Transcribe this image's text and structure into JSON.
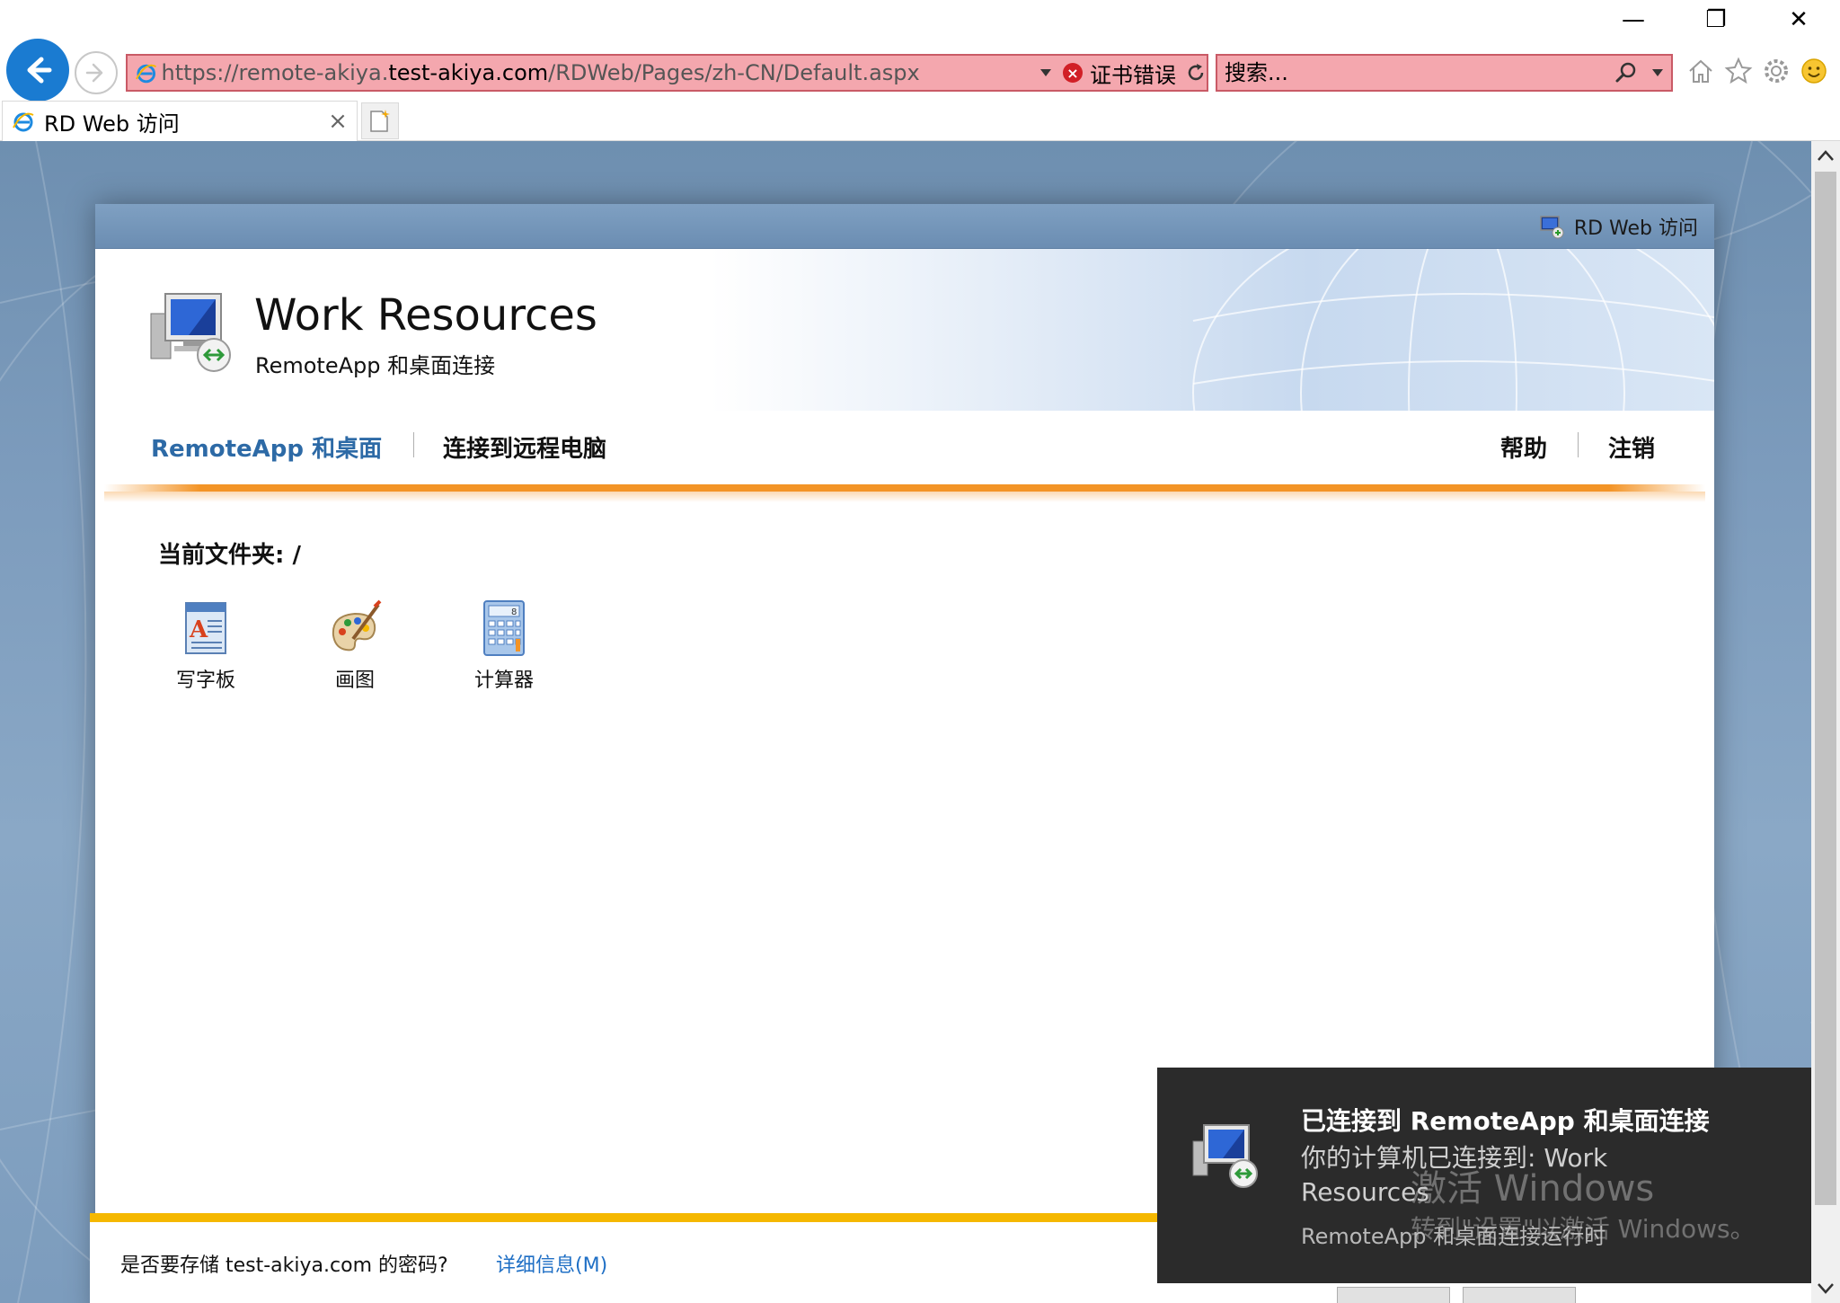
{
  "window": {
    "minimize_glyph": "—",
    "restore_glyph": "❐",
    "close_glyph": "✕"
  },
  "address": {
    "url_prefix": "https://remote-akiya.",
    "url_host": "test-akiya.com",
    "url_path": "/RDWeb/Pages/zh-CN/Default.aspx",
    "cert_error": "证书错误"
  },
  "search": {
    "placeholder": "搜索..."
  },
  "tab": {
    "title": "RD Web 访问",
    "close_glyph": "×"
  },
  "panel": {
    "topbar_label": "RD Web 访问",
    "title": "Work Resources",
    "subtitle": "RemoteApp 和桌面连接"
  },
  "nav": {
    "remoteapp": "RemoteApp 和桌面",
    "connect": "连接到远程电脑",
    "help": "帮助",
    "logout": "注销"
  },
  "folder": {
    "label": "当前文件夹: /"
  },
  "apps": [
    {
      "label": "写字板",
      "icon": "wordpad-icon"
    },
    {
      "label": "画图",
      "icon": "paint-icon"
    },
    {
      "label": "计算器",
      "icon": "calculator-icon"
    }
  ],
  "password_bar": {
    "question": "是否要存储 test-akiya.com 的密码?",
    "details": "详细信息(M)"
  },
  "toast": {
    "title": "已连接到 RemoteApp 和桌面连接",
    "body": "你的计算机已连接到: Work Resources",
    "footer": "RemoteApp 和桌面连接运行时"
  },
  "watermark": {
    "title": "激活 Windows",
    "subtitle": "转到\"设置\"以激活 Windows。"
  },
  "colors": {
    "accent_blue": "#2d6aa6",
    "orange": "#f39426",
    "error_red": "#f4a7ae",
    "back_blue": "#1a7bd1"
  }
}
